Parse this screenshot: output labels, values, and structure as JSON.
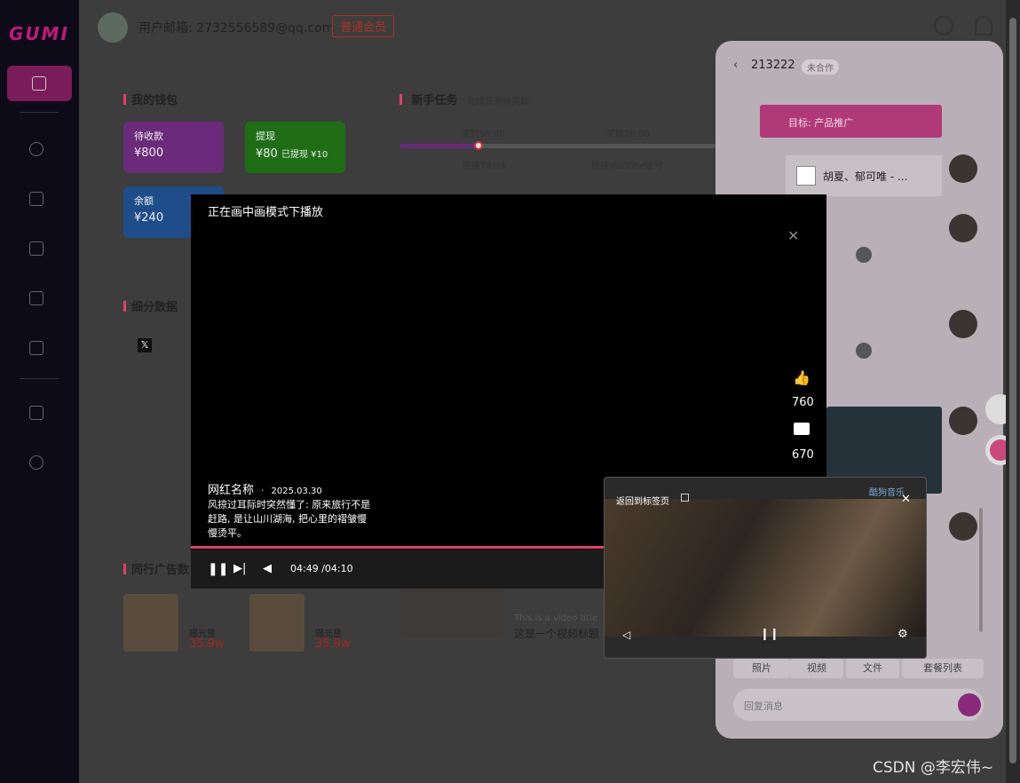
{
  "header": {
    "email_label": "用户邮箱: 2732556589@qq.com",
    "member_badge": "普通会员"
  },
  "logo": {
    "text": "GUMI"
  },
  "wallet": {
    "title": "我的钱包",
    "cards": [
      {
        "label": "待收款",
        "value": "¥800"
      },
      {
        "label": "提现",
        "value": "¥80",
        "extra": "已提现 ¥10"
      },
      {
        "label": "余额",
        "value": "¥240"
      }
    ]
  },
  "tasks": {
    "title": "新手任务",
    "subtitle": "完成任务赚奖励",
    "rewards": [
      "奖励50.00",
      "奖励20.00"
    ],
    "steps": [
      "链接Tiktok",
      "链接YouTube账号"
    ]
  },
  "stats": {
    "title": "细分数据"
  },
  "ads": {
    "title": "同行广告数",
    "items": [
      {
        "label": "曝光量",
        "value": "35.9w"
      },
      {
        "label": "曝光量",
        "value": "35.9w"
      }
    ],
    "video_title_en": "This is a video title",
    "video_title": "这是一个视频标题"
  },
  "chat": {
    "contact": "213222",
    "status": "未合作",
    "goal": "目标: 产品推广",
    "card_title": "胡夏、郁可唯 - ...",
    "tools": [
      "照片",
      "视频",
      "文件",
      "套餐列表"
    ],
    "reply_placeholder": "回复消息"
  },
  "video": {
    "pip_text": "正在画中画模式下播放",
    "likes": "760",
    "comments": "670",
    "author": "网红名称",
    "date": "2025.03.30",
    "caption": "风掠过耳际时突然懂了: 原来旅行不是赶路, 是让山川湖海, 把心里的褶皱慢慢烫平。",
    "time_current": "04:49",
    "time_total": "/04:10"
  },
  "mini_player": {
    "back_label": "返回到标签页",
    "brand": "酷狗音乐"
  },
  "watermark": "CSDN @李宏伟~",
  "colors": {
    "accent": "#e53e6a",
    "purple": "#8e2de2",
    "green": "#2e9b1e",
    "blue": "#2a6fd6"
  }
}
